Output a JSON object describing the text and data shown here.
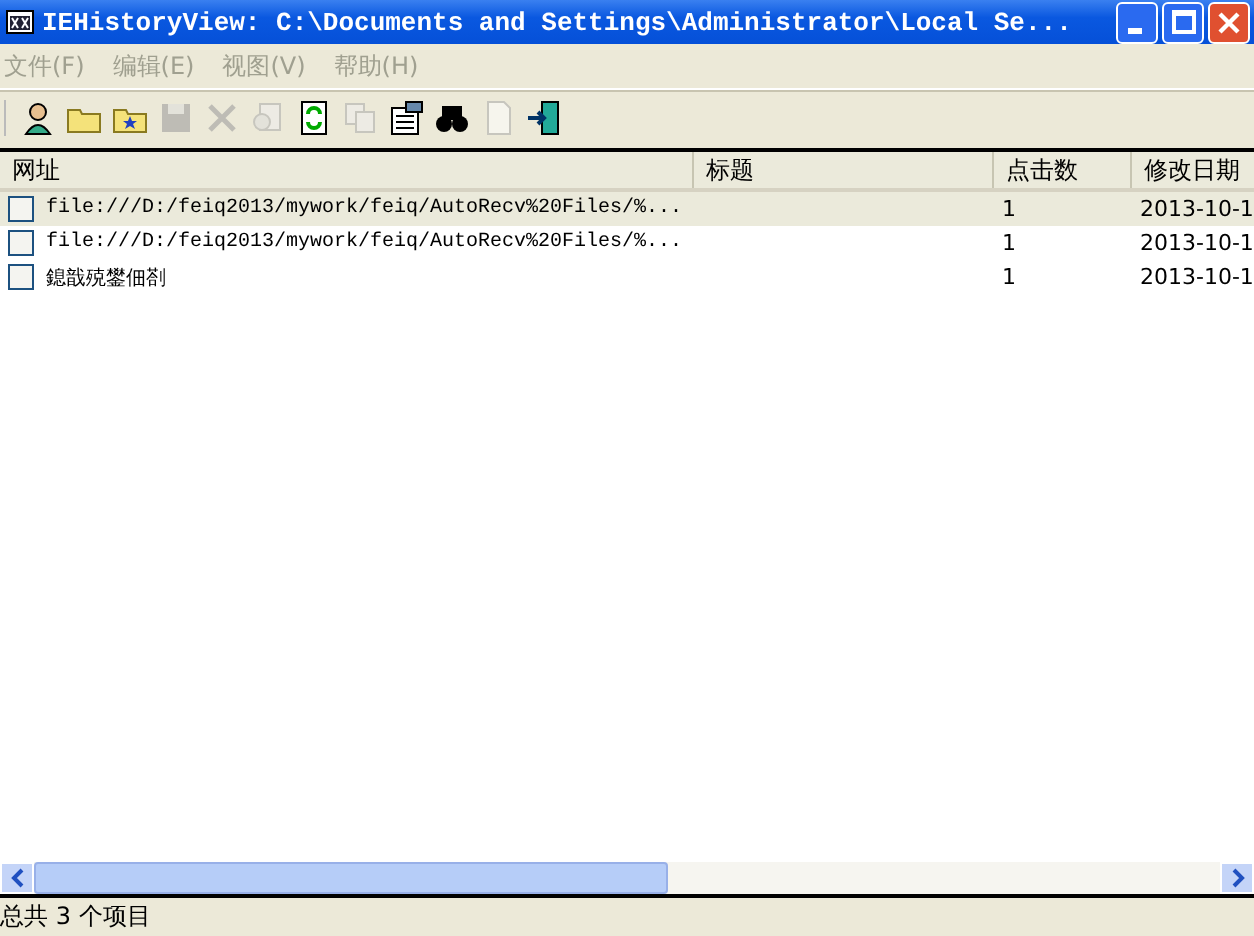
{
  "window": {
    "title": "IEHistoryView:  C:\\Documents and Settings\\Administrator\\Local Se..."
  },
  "menu": [
    {
      "label": "文件(F)",
      "disabled": true
    },
    {
      "label": "编辑(E)",
      "disabled": true
    },
    {
      "label": "视图(V)",
      "disabled": true
    },
    {
      "label": "帮助(H)",
      "disabled": true
    }
  ],
  "toolbar": [
    {
      "kind": "person",
      "disabled": false
    },
    {
      "kind": "folder",
      "disabled": false
    },
    {
      "kind": "star-folder",
      "disabled": false
    },
    {
      "kind": "save",
      "disabled": true
    },
    {
      "kind": "delete",
      "disabled": true
    },
    {
      "kind": "doc-globe",
      "disabled": true
    },
    {
      "kind": "refresh",
      "disabled": false
    },
    {
      "kind": "copy",
      "disabled": true
    },
    {
      "kind": "properties",
      "disabled": false
    },
    {
      "kind": "find",
      "disabled": false
    },
    {
      "kind": "page",
      "disabled": true
    },
    {
      "kind": "exit",
      "disabled": false
    }
  ],
  "table": {
    "columns": [
      "网址",
      "标题",
      "点击数",
      "修改日期"
    ],
    "rows": [
      {
        "selected": true,
        "checked": false,
        "cells": [
          "file:///D:/feiq2013/mywork/feiq/AutoRecv%20Files/%...",
          "",
          "1",
          "2013-10-1"
        ]
      },
      {
        "selected": false,
        "checked": false,
        "cells": [
          "file:///D:/feiq2013/mywork/feiq/AutoRecv%20Files/%...",
          "",
          "1",
          "2013-10-1"
        ]
      },
      {
        "selected": false,
        "checked": false,
        "cells": [
          "鎴戠殑鐢佃剳",
          "",
          "1",
          "2013-10-1"
        ]
      }
    ]
  },
  "status_bar": {
    "text": "总共 3 个项目"
  }
}
